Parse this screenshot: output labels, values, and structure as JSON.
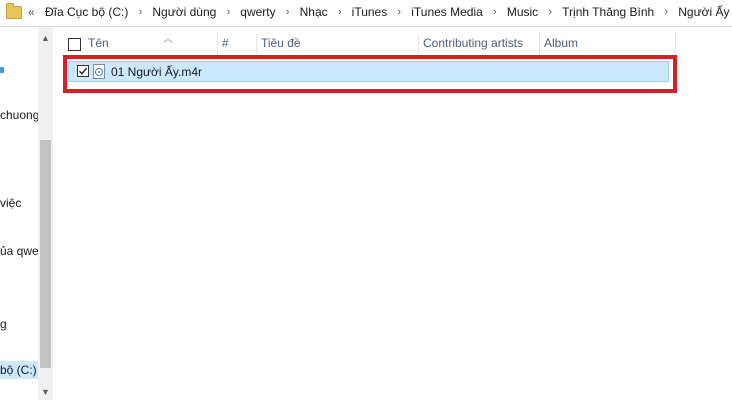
{
  "address": {
    "overflow": "«",
    "crumbs": [
      "Đĩa Cục bộ (C:)",
      "Người dùng",
      "qwerty",
      "Nhạc",
      "iTunes",
      "iTunes Media",
      "Music",
      "Trịnh Thăng Bình",
      "Người Ấy"
    ],
    "separator": "›"
  },
  "nav": {
    "items": [
      {
        "label": "chuong"
      },
      {
        "label": "việc"
      },
      {
        "label": "ủa qwer"
      },
      {
        "label": "g"
      },
      {
        "label": "bộ (C:)"
      }
    ]
  },
  "columns": {
    "name": "Tên",
    "number": "#",
    "title": "Tiêu đề",
    "artists": "Contributing artists",
    "album": "Album"
  },
  "files": [
    {
      "name": "01 Người Ấy.m4r",
      "checked": true
    }
  ],
  "colors": {
    "selection": "#cce8ff",
    "highlight": "#d61f26"
  },
  "icons": {
    "folder": "folder-icon",
    "file": "audio-file-icon",
    "check": "checkmark-icon"
  }
}
